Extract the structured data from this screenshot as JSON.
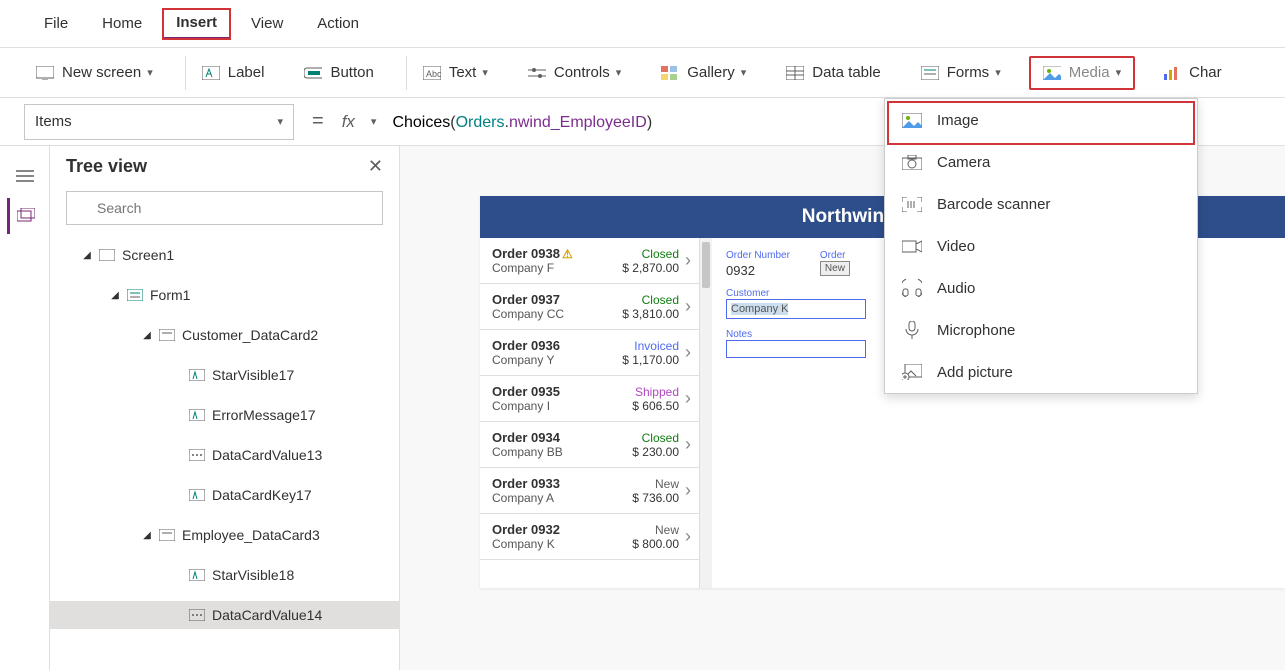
{
  "menu": {
    "file": "File",
    "home": "Home",
    "insert": "Insert",
    "view": "View",
    "action": "Action"
  },
  "ribbon": {
    "new_screen": "New screen",
    "label": "Label",
    "button": "Button",
    "text": "Text",
    "controls": "Controls",
    "gallery": "Gallery",
    "data_table": "Data table",
    "forms": "Forms",
    "media": "Media",
    "charts": "Char"
  },
  "property_selector": "Items",
  "formula": {
    "fn": "Choices",
    "open": "(",
    "type": "Orders",
    "dot": ".",
    "prop": "nwind_EmployeeID",
    "close": ")"
  },
  "panel": {
    "title": "Tree view",
    "search_placeholder": "Search"
  },
  "tree": {
    "screen1": "Screen1",
    "form1": "Form1",
    "customer_dc": "Customer_DataCard2",
    "starvisible17": "StarVisible17",
    "errormessage17": "ErrorMessage17",
    "datacardvalue13": "DataCardValue13",
    "datacardkey17": "DataCardKey17",
    "employee_dc": "Employee_DataCard3",
    "starvisible18": "StarVisible18",
    "datacardvalue14": "DataCardValue14"
  },
  "app": {
    "title": "Northwind Orders"
  },
  "form": {
    "order_number_lbl": "Order Number",
    "order_number_val": "0932",
    "order_something_lbl": "Order",
    "status_btn": "New",
    "customer_lbl": "Customer",
    "customer_val": "Company K",
    "notes_lbl": "Notes"
  },
  "orders": [
    {
      "id": "Order 0938",
      "company": "Company F",
      "status": "Closed",
      "status_cls": "st-closed",
      "amount": "$ 2,870.00",
      "warn": true
    },
    {
      "id": "Order 0937",
      "company": "Company CC",
      "status": "Closed",
      "status_cls": "st-closed",
      "amount": "$ 3,810.00"
    },
    {
      "id": "Order 0936",
      "company": "Company Y",
      "status": "Invoiced",
      "status_cls": "st-invoiced",
      "amount": "$ 1,170.00"
    },
    {
      "id": "Order 0935",
      "company": "Company I",
      "status": "Shipped",
      "status_cls": "st-shipped",
      "amount": "$ 606.50"
    },
    {
      "id": "Order 0934",
      "company": "Company BB",
      "status": "Closed",
      "status_cls": "st-closed",
      "amount": "$ 230.00"
    },
    {
      "id": "Order 0933",
      "company": "Company A",
      "status": "New",
      "status_cls": "st-new",
      "amount": "$ 736.00"
    },
    {
      "id": "Order 0932",
      "company": "Company K",
      "status": "New",
      "status_cls": "st-new",
      "amount": "$ 800.00"
    }
  ],
  "media_menu": {
    "image": "Image",
    "camera": "Camera",
    "barcode": "Barcode scanner",
    "video": "Video",
    "audio": "Audio",
    "microphone": "Microphone",
    "add_picture": "Add picture"
  }
}
